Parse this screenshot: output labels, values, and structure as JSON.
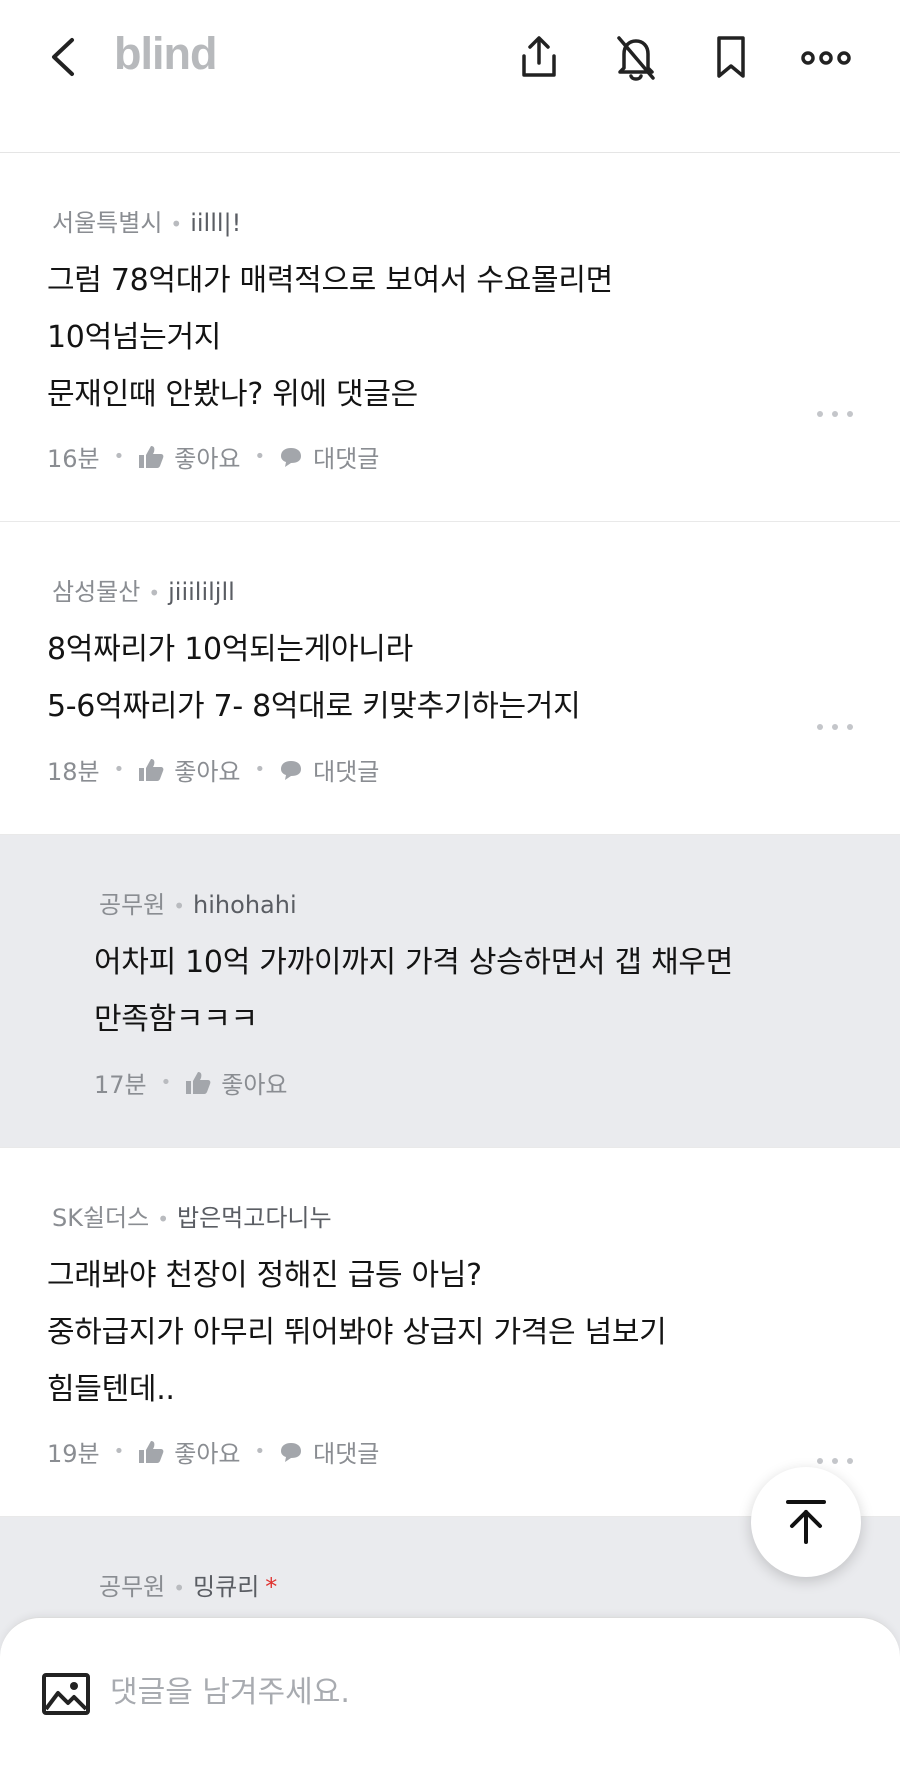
{
  "header": {
    "logo": "blind",
    "icons": [
      "back-chevron-icon",
      "share-icon",
      "notification-off-icon",
      "bookmark-icon",
      "more-icon"
    ]
  },
  "comments": [
    {
      "company": "서울특별시",
      "nickname": "iilll|!",
      "lines": [
        "그럼 78억대가 매력적으로 보여서 수요몰리면",
        "10억넘는거지",
        "문재인때 안봤나? 위에 댓글은"
      ],
      "time": "16분",
      "like_label": "좋아요",
      "reply_label": "대댓글"
    },
    {
      "company": "삼성물산",
      "nickname": "jiiililjll",
      "lines": [
        "8억짜리가 10억되는게아니라",
        "5-6억짜리가 7- 8억대로 키맞추기하는거지"
      ],
      "time": "18분",
      "like_label": "좋아요",
      "reply_label": "대댓글"
    },
    {
      "company": "공무원",
      "nickname": "hihohahi",
      "lines": [
        "어차피 10억 가까이까지 가격 상승하면서 갭 채우면",
        "만족함ㅋㅋㅋ"
      ],
      "time": "17분",
      "like_label": "좋아요"
    },
    {
      "company": "SK쉴더스",
      "nickname": "밥은먹고다니누",
      "lines": [
        "그래봐야 천장이 정해진 급등 아님?",
        "중하급지가 아무리 뛰어봐야 상급지 가격은 넘보기",
        "힘들텐데.."
      ],
      "time": "19분",
      "like_label": "좋아요",
      "reply_label": "대댓글"
    },
    {
      "company": "공무원",
      "nickname": "밍큐리",
      "author_mark": "*"
    }
  ],
  "input": {
    "placeholder": "댓글을 남겨주세요."
  },
  "colors": {
    "logo": "#b7b9bc",
    "reply_background": "#eaebee",
    "meta_text": "#8a8d92",
    "author_mark": "#e0312e"
  }
}
